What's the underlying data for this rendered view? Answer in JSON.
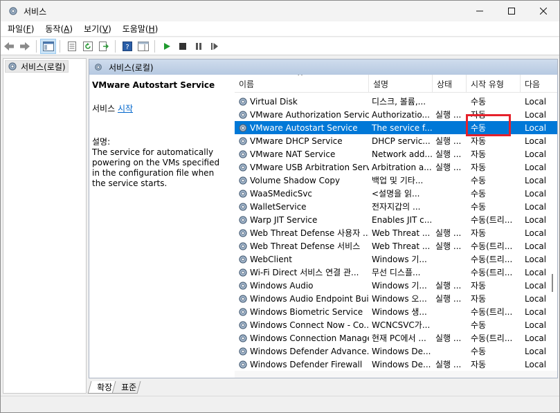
{
  "window": {
    "title": "서비스"
  },
  "menu": [
    {
      "label": "파일",
      "key": "F"
    },
    {
      "label": "동작",
      "key": "A"
    },
    {
      "label": "보기",
      "key": "V"
    },
    {
      "label": "도움말",
      "key": "H"
    }
  ],
  "toolbar": {
    "icons": [
      "back-icon",
      "forward-icon",
      "console-tree-icon",
      "properties-icon",
      "refresh-icon",
      "export-icon",
      "help-icon",
      "show-hide-icon",
      "start-icon",
      "stop-icon",
      "pause-icon",
      "restart-icon"
    ]
  },
  "tree": {
    "root_label": "서비스(로컬)"
  },
  "pane": {
    "header": "서비스(로컬)"
  },
  "detail": {
    "service_name": "VMware Autostart Service",
    "start_prefix": "서비스 ",
    "start_link": "시작",
    "desc_label": "설명:",
    "desc_text": "The service for automatically powering on the VMs specified in the configuration file when the service starts."
  },
  "columns": {
    "name": "이름",
    "desc": "설명",
    "status": "상태",
    "type": "시작 유형",
    "logon": "다음"
  },
  "services": [
    {
      "name": "Virtual Disk",
      "desc": "디스크, 볼륨,...",
      "status": "",
      "type": "수동",
      "logon": "Local"
    },
    {
      "name": "VMware Authorization Service",
      "desc": "Authorizatio...",
      "status": "실행 ...",
      "type": "자동",
      "logon": "Local"
    },
    {
      "name": "VMware Autostart Service",
      "desc": "The service f...",
      "status": "",
      "type": "수동",
      "logon": "Local",
      "selected": true
    },
    {
      "name": "VMware DHCP Service",
      "desc": "DHCP servic...",
      "status": "실행 ...",
      "type": "자동",
      "logon": "Local"
    },
    {
      "name": "VMware NAT Service",
      "desc": "Network add...",
      "status": "실행 ...",
      "type": "자동",
      "logon": "Local"
    },
    {
      "name": "VMware USB Arbitration Serv...",
      "desc": "Arbitration a...",
      "status": "실행 ...",
      "type": "자동",
      "logon": "Local"
    },
    {
      "name": "Volume Shadow Copy",
      "desc": "백업 및 기타...",
      "status": "",
      "type": "수동",
      "logon": "Local"
    },
    {
      "name": "WaaSMedicSvc",
      "desc": "<설명을 읽...",
      "status": "",
      "type": "수동",
      "logon": "Local"
    },
    {
      "name": "WalletService",
      "desc": "전자지갑의 ...",
      "status": "",
      "type": "수동",
      "logon": "Local"
    },
    {
      "name": "Warp JIT Service",
      "desc": "Enables JIT c...",
      "status": "",
      "type": "수동(트리...",
      "logon": "Local"
    },
    {
      "name": "Web Threat Defense 사용자 ...",
      "desc": "Web Threat ...",
      "status": "실행 ...",
      "type": "자동",
      "logon": "Local"
    },
    {
      "name": "Web Threat Defense 서비스",
      "desc": "Web Threat ...",
      "status": "실행 ...",
      "type": "수동(트리...",
      "logon": "Local"
    },
    {
      "name": "WebClient",
      "desc": "Windows 기...",
      "status": "",
      "type": "수동(트리...",
      "logon": "Local"
    },
    {
      "name": "Wi-Fi Direct 서비스 연결 관...",
      "desc": "무선 디스플...",
      "status": "",
      "type": "수동(트리...",
      "logon": "Local"
    },
    {
      "name": "Windows Audio",
      "desc": "Windows 기...",
      "status": "실행 ...",
      "type": "자동",
      "logon": "Local"
    },
    {
      "name": "Windows Audio Endpoint Bui...",
      "desc": "Windows 오...",
      "status": "실행 ...",
      "type": "자동",
      "logon": "Local"
    },
    {
      "name": "Windows Biometric Service",
      "desc": "Windows 생...",
      "status": "",
      "type": "수동(트리...",
      "logon": "Local"
    },
    {
      "name": "Windows Connect Now - Co...",
      "desc": "WCNCSVC가...",
      "status": "",
      "type": "수동",
      "logon": "Local"
    },
    {
      "name": "Windows Connection Manager",
      "desc": "현재 PC에서 ...",
      "status": "실행 ...",
      "type": "수동(트리...",
      "logon": "Local"
    },
    {
      "name": "Windows Defender Advance...",
      "desc": "Windows De...",
      "status": "",
      "type": "수동",
      "logon": "Local"
    },
    {
      "name": "Windows Defender Firewall",
      "desc": "Windows De...",
      "status": "실행 ...",
      "type": "자동",
      "logon": "Local"
    }
  ],
  "tabs": [
    "확장",
    "표준"
  ],
  "colors": {
    "selection": "#0078d7",
    "highlight_box": "#e5212b",
    "link": "#0066cc"
  }
}
